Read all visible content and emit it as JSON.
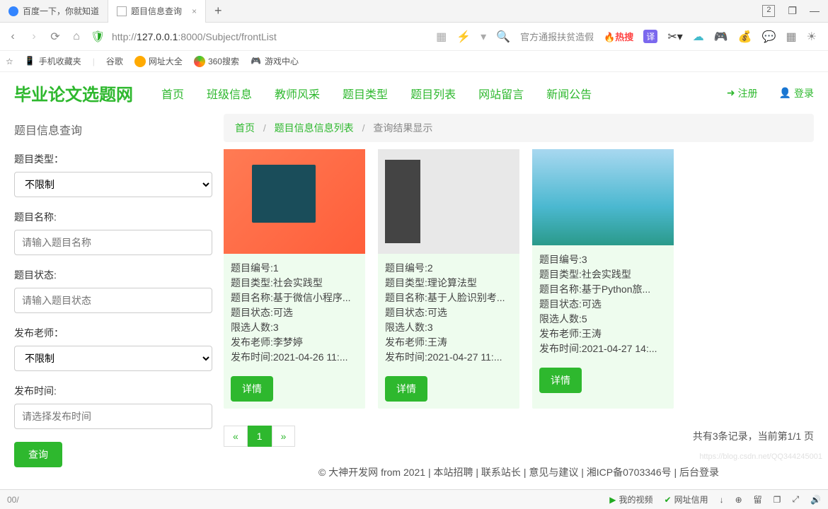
{
  "browser": {
    "tabs": [
      {
        "title": "百度一下，你就知道",
        "active": false
      },
      {
        "title": "题目信息查询",
        "active": true
      }
    ],
    "win_box": "2",
    "url_prefix": "http://",
    "url_host": "127.0.0.1",
    "url_port": ":8000",
    "url_path": "/Subject/frontList",
    "search_hint": "官方通报扶贫造假",
    "hot_label": "热搜",
    "bookmarks": [
      "手机收藏夹",
      "谷歌",
      "网址大全",
      "360搜索",
      "游戏中心"
    ]
  },
  "site": {
    "logo": "毕业论文选题网",
    "nav": [
      "首页",
      "班级信息",
      "教师风采",
      "题目类型",
      "题目列表",
      "网站留言",
      "新闻公告"
    ],
    "register": "注册",
    "login": "登录"
  },
  "sidebar": {
    "title": "题目信息查询",
    "type_label": "题目类型：",
    "type_value": "不限制",
    "name_label": "题目名称:",
    "name_placeholder": "请输入题目名称",
    "status_label": "题目状态:",
    "status_placeholder": "请输入题目状态",
    "teacher_label": "发布老师：",
    "teacher_value": "不限制",
    "date_label": "发布时间:",
    "date_placeholder": "请选择发布时间",
    "query_btn": "查询"
  },
  "breadcrumb": {
    "home": "首页",
    "list": "题目信息信息列表",
    "current": "查询结果显示"
  },
  "cards": [
    {
      "id": "题目编号:1",
      "type": "题目类型:社会实践型",
      "name": "题目名称:基于微信小程序...",
      "status": "题目状态:可选",
      "limit": "限选人数:3",
      "teacher": "发布老师:李梦婷",
      "time": "发布时间:2021-04-26 11:...",
      "detail": "详情"
    },
    {
      "id": "题目编号:2",
      "type": "题目类型:理论算法型",
      "name": "题目名称:基于人脸识别考...",
      "status": "题目状态:可选",
      "limit": "限选人数:3",
      "teacher": "发布老师:王涛",
      "time": "发布时间:2021-04-27 11:...",
      "detail": "详情"
    },
    {
      "id": "题目编号:3",
      "type": "题目类型:社会实践型",
      "name": "题目名称:基于Python旅...",
      "status": "题目状态:可选",
      "limit": "限选人数:5",
      "teacher": "发布老师:王涛",
      "time": "发布时间:2021-04-27 14:...",
      "detail": "详情"
    }
  ],
  "pagination": {
    "prev": "«",
    "current": "1",
    "next": "»",
    "info": "共有3条记录，当前第1/1 页"
  },
  "footer": "© 大神开发网 from 2021 | 本站招聘 | 联系站长 | 意见与建议 | 湘ICP备0703346号 | 后台登录",
  "statusbar": {
    "left": "00/",
    "items": [
      "我的视频",
      "网址信用",
      "下载",
      "⊕",
      "留",
      "口",
      "⤢",
      "🔊"
    ]
  },
  "watermark": "https://blog.csdn.net/QQ344245001"
}
